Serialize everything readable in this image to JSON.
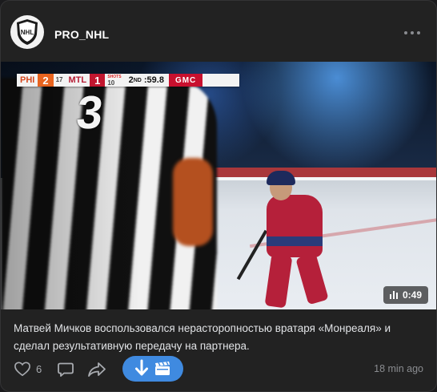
{
  "channel": {
    "name": "PRO_NHL",
    "avatar_icon": "nhl-shield-logo"
  },
  "video": {
    "duration": "0:49",
    "scorebug": {
      "team_home": "PHI",
      "score_home": "2",
      "sog_home": "17",
      "team_away": "MTL",
      "score_away": "1",
      "sog_label_away": "SHOTS",
      "sog_away": "10",
      "period": "2",
      "period_suffix": "ND",
      "clock": ":59.8",
      "sponsor": "GMC"
    },
    "jersey_number": "3"
  },
  "post": {
    "text": "Матвей Мичков воспользовался нерасторопностью вратаря «Монреаля» и сделал результативную передачу на партнера."
  },
  "footer": {
    "likes": "6",
    "time_ago": "18 min ago",
    "icons": [
      "heart-icon",
      "comment-icon",
      "share-icon",
      "download-arrow-icon",
      "clapperboard-icon"
    ]
  },
  "colors": {
    "accent": "#3f8ae0",
    "background": "#222222",
    "text": "#e1e3e6",
    "muted": "#8a8c90"
  }
}
